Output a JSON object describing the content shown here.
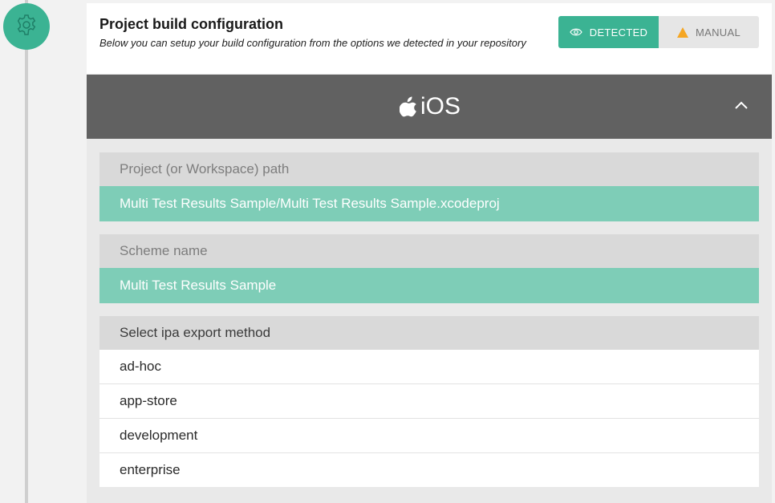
{
  "step": {
    "icon": "gear-icon"
  },
  "header": {
    "title": "Project build configuration",
    "subtitle": "Below you can setup your build configuration from the options we detected in your repository",
    "toggle": {
      "detected_label": "DETECTED",
      "detected_icon": "eye-icon",
      "manual_label": "MANUAL",
      "manual_icon": "warning-triangle-icon",
      "selected": "DETECTED"
    }
  },
  "platform": {
    "icon": "apple-icon",
    "label": "iOS",
    "collapse_icon": "chevron-up-icon"
  },
  "fields": {
    "project_path": {
      "label": "Project (or Workspace) path",
      "value": "Multi Test Results Sample/Multi Test Results Sample.xcodeproj"
    },
    "scheme": {
      "label": "Scheme name",
      "value": "Multi Test Results Sample"
    }
  },
  "export": {
    "label": "Select ipa export method",
    "options": [
      "ad-hoc",
      "app-store",
      "development",
      "enterprise"
    ]
  },
  "colors": {
    "accent": "#3bb393",
    "accent_light": "#7ecdb7",
    "platform_bar": "#616161",
    "warning": "#f5a623"
  }
}
